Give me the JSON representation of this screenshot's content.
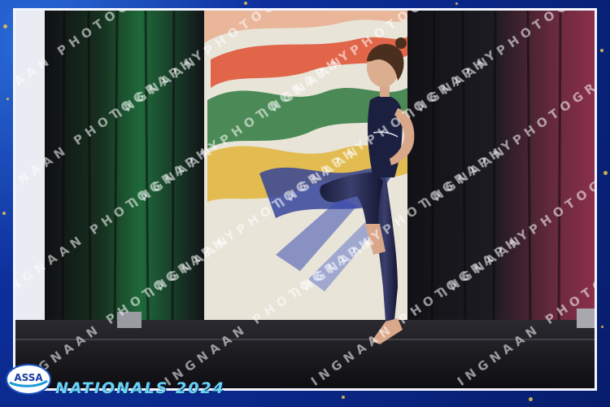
{
  "photo": {
    "subject": "dancer",
    "watermark_text": "INGNAAN PHOTOGRAPHY",
    "colors": {
      "curtain_dark": "#16161c",
      "curtain_green": "#1f6a3a",
      "curtain_pink": "#8a2f4a",
      "backdrop": "#e8e4d8",
      "frame_blue": "#0d2f9c",
      "gold": "#f0c54a",
      "accent_cyan": "#6ad3f0"
    }
  },
  "branding": {
    "logo_text": "ASSA",
    "event_title": "NATIONALS 2024"
  }
}
